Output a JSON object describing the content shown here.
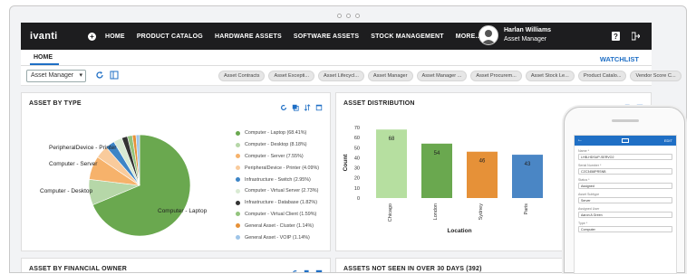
{
  "nav": {
    "logo": "ivanti",
    "items": [
      "HOME",
      "PRODUCT CATALOG",
      "HARDWARE ASSETS",
      "SOFTWARE ASSETS",
      "STOCK MANAGEMENT",
      "MORE..."
    ],
    "user_name": "Harlan Williams",
    "user_role": "Asset Manager"
  },
  "tabs": {
    "home": "HOME",
    "watchlist": "WATCHLIST"
  },
  "filter": {
    "selected_role": "Asset Manager",
    "chips": [
      "Asset Contracts",
      "Asset Excepti...",
      "Asset Lifecycl...",
      "Asset Manager",
      "Asset Manager ...",
      "Asset Procurem...",
      "Asset Stock Le...",
      "Product Catalo...",
      "Vendor Score C..."
    ]
  },
  "panels": {
    "asset_by_type": "ASSET BY TYPE",
    "asset_distribution": "ASSET DISTRIBUTION",
    "financial_owner": "ASSET BY FINANCIAL OWNER",
    "not_seen": "ASSETS NOT SEEN IN OVER 30 DAYS (392)"
  },
  "chart_data": [
    {
      "type": "pie",
      "title": "ASSET BY TYPE",
      "slices": [
        {
          "name": "Computer - Laptop (68.41%)",
          "value": 68.41,
          "color": "#6aa84f"
        },
        {
          "name": "Computer - Desktop (8.18%)",
          "value": 8.18,
          "color": "#b6d7a8"
        },
        {
          "name": "Computer - Server (7.55%)",
          "value": 7.55,
          "color": "#f6b26b"
        },
        {
          "name": "PeripheralDevice - Printer (4.09%)",
          "value": 4.09,
          "color": "#f9cb9c"
        },
        {
          "name": "Infrastructure - Switch (2.95%)",
          "value": 2.95,
          "color": "#3d85c6"
        },
        {
          "name": "Computer - Virtual Server (2.73%)",
          "value": 2.73,
          "color": "#d9ead3"
        },
        {
          "name": "Infrastructure - Database (1.82%)",
          "value": 1.82,
          "color": "#333333"
        },
        {
          "name": "Computer - Virtual Client (1.59%)",
          "value": 1.59,
          "color": "#93c47d"
        },
        {
          "name": "General Asset - Cluster (1.14%)",
          "value": 1.14,
          "color": "#e69138"
        },
        {
          "name": "General Asset - VOIP (1.14%)",
          "value": 1.14,
          "color": "#9fc5e8"
        }
      ],
      "pie_labels": [
        "PeripheralDevice - Printer",
        "Computer - Server",
        "Computer - Desktop",
        "Computer - Laptop"
      ]
    },
    {
      "type": "bar",
      "title": "ASSET DISTRIBUTION",
      "categories": [
        "Chicago",
        "London",
        "Sydney",
        "Paris"
      ],
      "values": [
        68,
        54,
        46,
        43
      ],
      "colors": [
        "#b6dfa0",
        "#6aa84f",
        "#e69138",
        "#4a86c5"
      ],
      "xlabel": "Location",
      "ylabel": "Count",
      "ylim": [
        0,
        70
      ],
      "yticks": [
        0,
        10,
        20,
        30,
        40,
        50,
        60,
        70
      ]
    }
  ],
  "phone": {
    "header_left": "←",
    "header_right": "EDIT",
    "fields": [
      {
        "label": "Name *",
        "value": "LHB-HDSUP-SERVO2"
      },
      {
        "label": "Serial Number *",
        "value": "C2C3458PRSNB"
      },
      {
        "label": "Status *",
        "value": "Assigned"
      },
      {
        "label": "Asset Subtype",
        "value": "Server"
      },
      {
        "label": "Assigned User",
        "value": "Aaron A Green"
      },
      {
        "label": "Type *",
        "value": "Computer"
      }
    ]
  }
}
